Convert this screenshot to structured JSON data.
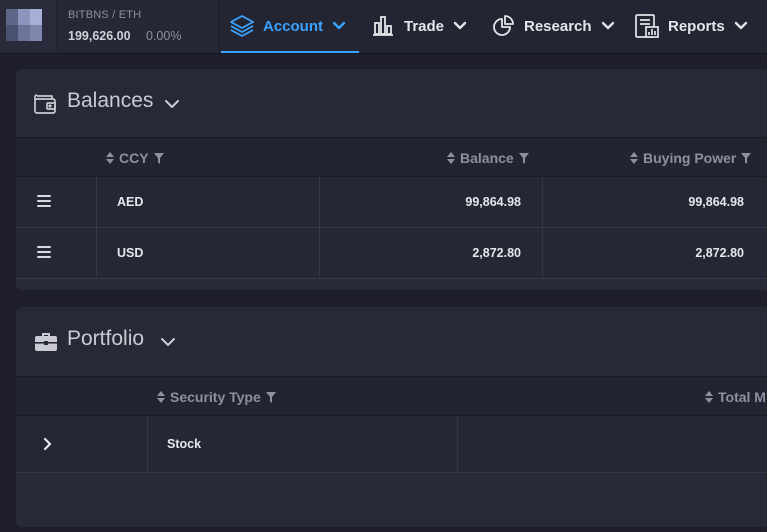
{
  "ticker": {
    "pair": "BITBNS / ETH",
    "price": "199,626.00",
    "change": "0.00%"
  },
  "nav": {
    "account": "Account",
    "trade": "Trade",
    "research": "Research",
    "reports": "Reports",
    "active": "Account",
    "accent_color": "#3aa3ff"
  },
  "balances": {
    "title": "Balances",
    "columns": {
      "ccy": "CCY",
      "balance": "Balance",
      "buying_power": "Buying Power"
    },
    "rows": [
      {
        "ccy": "AED",
        "balance": "99,864.98",
        "buying_power": "99,864.98"
      },
      {
        "ccy": "USD",
        "balance": "2,872.80",
        "buying_power": "2,872.80"
      }
    ]
  },
  "portfolio": {
    "title": "Portfolio",
    "columns": {
      "security_type": "Security Type",
      "total": "Total M"
    },
    "rows": [
      {
        "security_type": "Stock"
      }
    ]
  },
  "icons": {
    "account": "layers-icon",
    "trade": "bar-chart-icon",
    "research": "pie-chart-icon",
    "reports": "report-icon",
    "balances": "wallet-icon",
    "portfolio": "briefcase-icon"
  }
}
